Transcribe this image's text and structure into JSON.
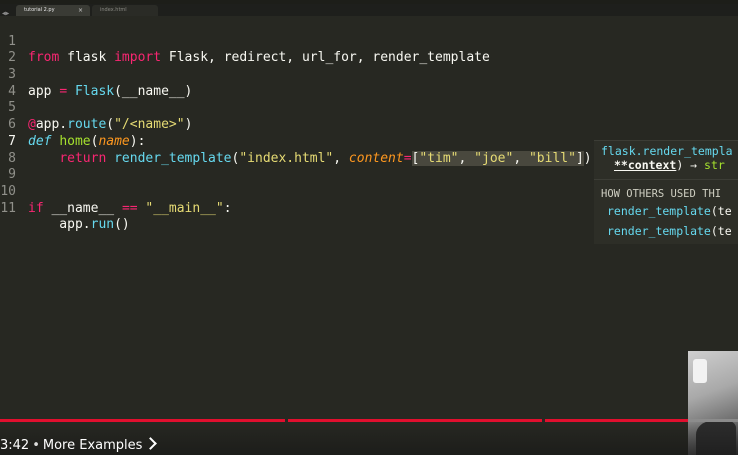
{
  "tabs": [
    {
      "label": "tutorial 2.py",
      "active": true
    },
    {
      "label": "index.html",
      "active": false
    }
  ],
  "editor": {
    "line_numbers": [
      "1",
      "2",
      "3",
      "4",
      "5",
      "6",
      "7",
      "8",
      "9",
      "10",
      "11"
    ],
    "active_line": "7"
  },
  "popup": {
    "signature_func": "flask.render_templa",
    "signature_context": "**context",
    "signature_return": ") → ",
    "signature_type": "str",
    "heading": "HOW OTHERS USED THI",
    "usages": [
      {
        "func": "render_template",
        "rest": "(te"
      },
      {
        "func": "render_template",
        "rest": "(te"
      }
    ]
  },
  "player": {
    "time": "3:42",
    "chapter": "More Examples"
  },
  "colors": {
    "background": "#272822",
    "progress": "#e10f2e",
    "keyword": "#f92672",
    "function": "#66d9ef",
    "string": "#e6db74",
    "parameter": "#fd971f"
  }
}
